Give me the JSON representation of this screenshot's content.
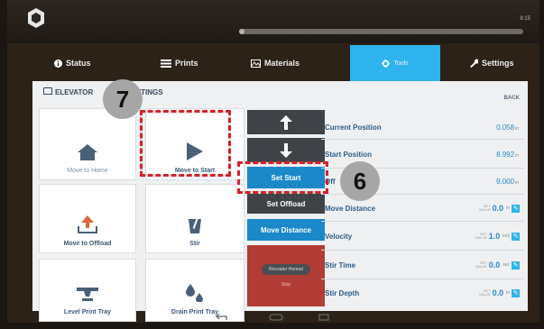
{
  "top": {
    "battery": "8:15"
  },
  "status_progress": 0.02,
  "tabs": [
    {
      "label": "Status",
      "icon": "info-icon"
    },
    {
      "label": "Prints",
      "icon": "list-icon"
    },
    {
      "label": "Materials",
      "icon": "materials-icon"
    },
    {
      "label": "Tools",
      "icon": "gear-icon",
      "active": true
    },
    {
      "label": "Settings",
      "icon": "wrench-icon"
    }
  ],
  "panel": {
    "title": "ELEVATOR",
    "title2": "TTINGS",
    "back": "BACK"
  },
  "tiles": {
    "move_home": "Move to Home",
    "move_start": "Move to Start",
    "move_offload": "Move to Offload",
    "stir": "Stir",
    "level_tray": "Level Print Tray",
    "drain_tray": "Drain Print Tray"
  },
  "controls": {
    "set_start": "Set Start",
    "set_offload": "Set Offload",
    "move_distance": "Move Distance",
    "homed": "Recoater Homed",
    "stop": "Stop"
  },
  "fields": {
    "current_position": {
      "label": "Current Position",
      "value": "0.058",
      "unit": "in"
    },
    "start_position": {
      "label": "Start Position",
      "value": "8.992",
      "unit": "in"
    },
    "offload_position": {
      "label": "Off",
      "value": "9.000",
      "unit": "in"
    },
    "move_distance": {
      "label": "Move Distance",
      "value": "0.0",
      "unit": "in"
    },
    "velocity": {
      "label": "Velocity",
      "value": "1.0",
      "unit": "in/s"
    },
    "stir_time": {
      "label": "Stir Time",
      "value": "0.0",
      "unit": "sec"
    },
    "stir_depth": {
      "label": "Stir Depth",
      "value": "0.0",
      "unit": "in"
    },
    "set_label1": "SET",
    "set_label2": "VALUE"
  },
  "annotations": {
    "badge_7": "7",
    "badge_6": "6"
  },
  "colors": {
    "accent": "#2fb3ec",
    "highlight": "#d71f2a",
    "homed": "#b23c36"
  }
}
